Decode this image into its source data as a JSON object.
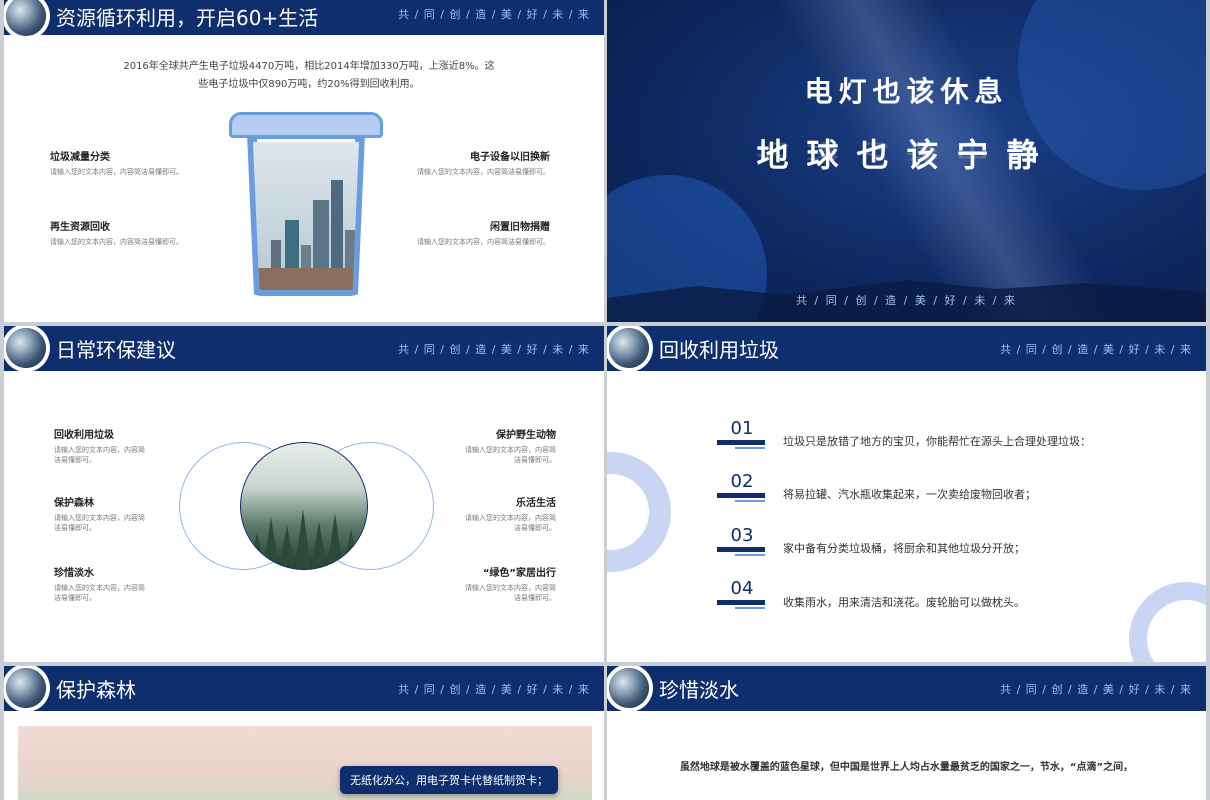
{
  "common": {
    "slogan": "共 / 同 / 创 / 造 / 美 / 好 / 未 / 来"
  },
  "slide1": {
    "title": "资源循环利用，开启60+生活",
    "intro_line1": "2016年全球共产生电子垃圾4470万吨，相比2014年增加330万吨，上涨近8%。这",
    "intro_line2": "些电子垃圾中仅890万吨，约20%得到回收利用。",
    "features": [
      {
        "title": "垃圾减量分类",
        "desc": "请输入您的文本内容，内容简洁易懂即可。"
      },
      {
        "title": "再生资源回收",
        "desc": "请输入您的文本内容，内容简洁易懂即可。"
      },
      {
        "title": "电子设备以旧换新",
        "desc": "请输入您的文本内容，内容简洁易懂即可。"
      },
      {
        "title": "闲置旧物捐赠",
        "desc": "请输入您的文本内容，内容简洁易懂即可。"
      }
    ]
  },
  "slide2": {
    "line1": "电灯也该休息",
    "line2": "地球也该宁静",
    "slogan": "共 / 同 / 创 / 造 / 美 / 好 / 未 / 来"
  },
  "slide3": {
    "title": "日常环保建议",
    "items": [
      {
        "title": "回收利用垃圾",
        "desc1": "请输入您的文本内容，内容简",
        "desc2": "洁易懂即可。"
      },
      {
        "title": "保护森林",
        "desc1": "请输入您的文本内容，内容简",
        "desc2": "洁易懂即可。"
      },
      {
        "title": "珍惜淡水",
        "desc1": "请输入您的文本内容，内容简",
        "desc2": "洁易懂即可。"
      },
      {
        "title": "保护野生动物",
        "desc1": "请输入您的文本内容，内容简",
        "desc2": "洁易懂即可。"
      },
      {
        "title": "乐活生活",
        "desc1": "请输入您的文本内容，内容简",
        "desc2": "洁易懂即可。"
      },
      {
        "title": "“绿色”家居出行",
        "desc1": "请输入您的文本内容，内容简",
        "desc2": "洁易懂即可。"
      }
    ]
  },
  "slide4": {
    "title": "回收利用垃圾",
    "items": [
      {
        "num": "01",
        "text": "垃圾只是放错了地方的宝贝，你能帮忙在源头上合理处理垃圾："
      },
      {
        "num": "02",
        "text": "将易拉罐、汽水瓶收集起来，一次卖给废物回收者；"
      },
      {
        "num": "03",
        "text": "家中备有分类垃圾桶，将厨余和其他垃圾分开放；"
      },
      {
        "num": "04",
        "text": "收集雨水，用来清洁和浇花。废轮胎可以做枕头。"
      }
    ]
  },
  "slide5": {
    "title": "保护森林",
    "tip": "无纸化办公，用电子贺卡代替纸制贺卡；"
  },
  "slide6": {
    "title": "珍惜淡水",
    "paragraph": "虽然地球是被水覆盖的蓝色星球，但中国是世界上人均占水量最贫乏的国家之一，节水，“点滴”之间，"
  }
}
